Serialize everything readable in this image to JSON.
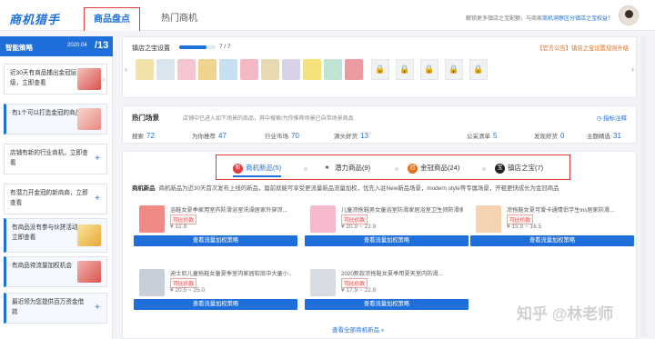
{
  "app": {
    "logo": "商机猎手"
  },
  "tabs": [
    {
      "label": "商品盘点"
    },
    {
      "label": "热门商机"
    }
  ],
  "top_notice": {
    "prefix": "解锁更多镇店之宝配额，与商家",
    "link": "商机洞察区分镇店之宝权益！"
  },
  "sidebar": {
    "title": "智能策略",
    "date": "2020.04",
    "day": "/13",
    "items": [
      {
        "text": "近30天有商品捕出金冠层级，立即查看"
      },
      {
        "text": "有1个可以打造金冠的商品"
      },
      {
        "text": "店铺有新的行业商机，立即查看"
      },
      {
        "text": "有潜力开金冠的新商商，立即查看"
      },
      {
        "text": "有商品没有参与伙拼活动，立即查看"
      },
      {
        "text": "有商品待流量加权机会"
      },
      {
        "text": "最近领为您提供百万资金借款"
      }
    ]
  },
  "store": {
    "label": "镇店之宝设置",
    "count": "7 / 7",
    "notice": "【官方公告】镇店之宝设置规则升级"
  },
  "scene": {
    "title": "热门场景",
    "desc": "店铺中已进入如下场景的商品，其中搜索/为你推荐场景已自带场景商品",
    "indicator": "◷ 指标注释",
    "metrics": [
      {
        "label": "搜索",
        "value": "72"
      },
      {
        "label": "为你推荐",
        "value": "47"
      },
      {
        "label": "行业市场",
        "value": "70"
      },
      {
        "label": "源头好货",
        "value": "13"
      },
      {
        "label": "公采清单",
        "value": "5"
      },
      {
        "label": "发现好货",
        "value": "0"
      },
      {
        "label": "主题精选",
        "value": "31"
      }
    ]
  },
  "opp_tabs": [
    {
      "label": "商机新品(5)",
      "color": "#e23b3b",
      "icon": "新"
    },
    {
      "label": "潜力商品(9)",
      "color": "#333333",
      "icon": "★"
    },
    {
      "label": "金冠商品(24)",
      "color": "#e0701e",
      "icon": "冠"
    },
    {
      "label": "镇店之宝(7)",
      "color": "#222222",
      "icon": "宝"
    }
  ],
  "opp_info": {
    "tag": "商机新品",
    "text": "商机新品为近30天首次发布上线的新品，届前就能可享受更流量新品流量加权，优先入驻New新品场景，modern style等专属场景，开粗更快成长为金冠商品"
  },
  "products": [
    {
      "title": "浴鞋女夏季家用室内防滑浴室洗澡居家外穿凉...",
      "badge": "可比价款",
      "price": "¥ 12.9",
      "button": "查看流量加权策略",
      "color": "#f08a86"
    },
    {
      "title": "儿童凉拖鞋男女童浴室防滑家居浴室卫生间防滑家...",
      "badge": "可比价款",
      "price": "¥ 20.9 ~ 22.9",
      "button": "查看流量加权策略",
      "color": "#f5b8cc"
    },
    {
      "title": "凉拖鞋女夏可爱卡通情侣学生ins居家防滑...",
      "badge": "可比价款",
      "price": "¥ 15.9 ~ 16.5",
      "button": "查看流量加权策略",
      "color": "#f6d3b0"
    },
    {
      "title": "迪士尼儿童拖鞋女童夏季室内家居软底中大童小...",
      "badge": "可比价款",
      "price": "¥ 20.5 ~ 25.0",
      "button": "查看流量加权策略",
      "color": "#c9cfd8"
    },
    {
      "title": "2020新款凉拖鞋女夏季用夏天室内防滑...",
      "badge": "可比价款",
      "price": "¥ 17.9 ~ 22.8",
      "button": "查看流量加权策略",
      "color": "#d8dde3"
    }
  ],
  "more_link": "查看全部商机新品 »",
  "store_products": [
    {
      "color": "#f3e2a8"
    },
    {
      "color": "#d9e6f0"
    },
    {
      "color": "#f4c6cf"
    },
    {
      "color": "#f0d38e"
    },
    {
      "color": "#c7e0ef"
    },
    {
      "color": "#f2b9c5"
    },
    {
      "color": "#e8dab0"
    },
    {
      "color": "#d6d2e8"
    },
    {
      "color": "#f6e07a"
    },
    {
      "color": "#bfe4d3"
    },
    {
      "color": "#ed9aa3"
    }
  ],
  "watermark": "知乎 @林老师"
}
